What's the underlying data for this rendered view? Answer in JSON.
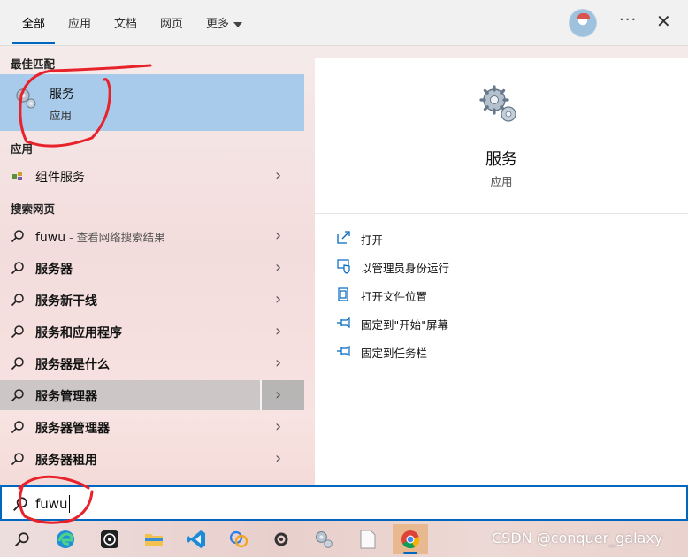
{
  "tabs": [
    "全部",
    "应用",
    "文档",
    "网页",
    "更多"
  ],
  "sections": {
    "best_match": "最佳匹配",
    "apps": "应用",
    "web": "搜索网页"
  },
  "best_match": {
    "title": "服务",
    "subtitle": "应用"
  },
  "app_results": [
    {
      "label": "组件服务"
    }
  ],
  "web_results": [
    {
      "label": "fuwu",
      "suffix": " - 查看网络搜索结果"
    },
    {
      "label": "服务器"
    },
    {
      "label": "服务新干线"
    },
    {
      "label": "服务和应用程序"
    },
    {
      "label": "服务器是什么"
    },
    {
      "label": "服务管理器"
    },
    {
      "label": "服务器管理器"
    },
    {
      "label": "服务器租用"
    }
  ],
  "detail": {
    "title": "服务",
    "subtitle": "应用",
    "actions": [
      "打开",
      "以管理员身份运行",
      "打开文件位置",
      "固定到\"开始\"屏幕",
      "固定到任务栏"
    ]
  },
  "search": {
    "value": "fuwu"
  },
  "watermark": "CSDN @conquer_galaxy",
  "colors": {
    "accent": "#0067c0",
    "selection": "#a9cbeb",
    "annotation": "#e8222a"
  }
}
